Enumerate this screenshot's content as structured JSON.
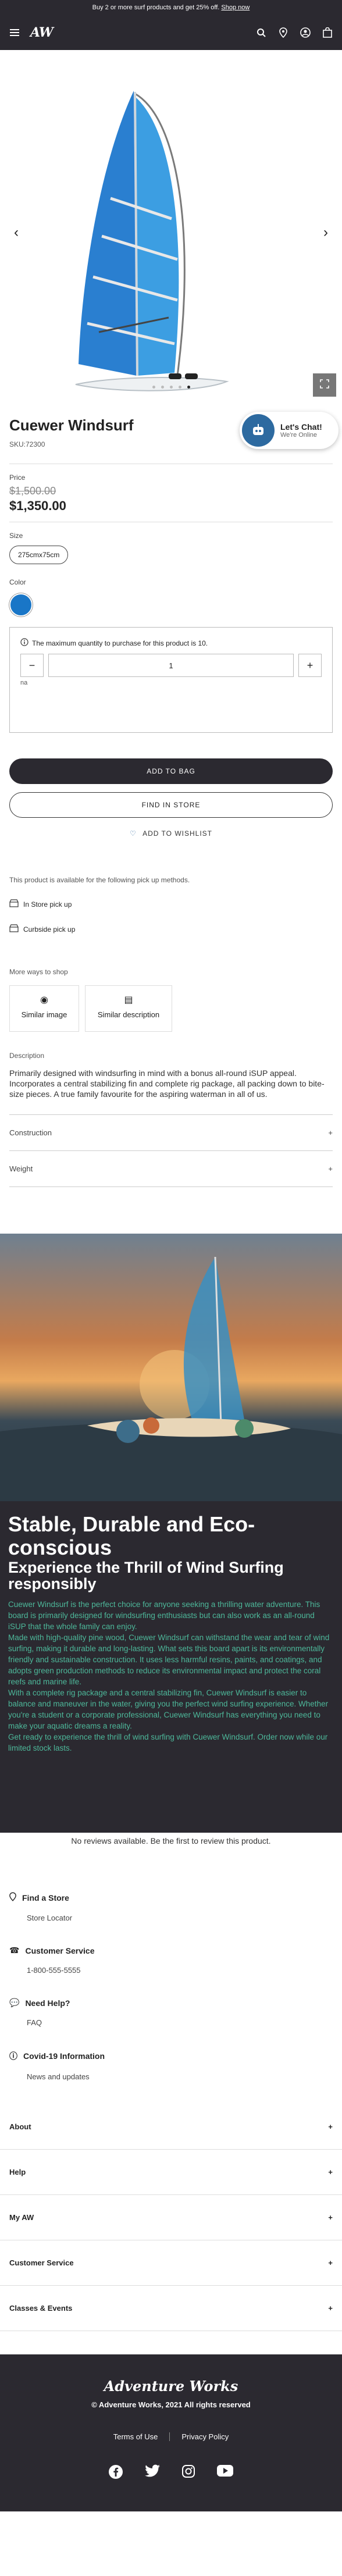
{
  "promo": {
    "text": "Buy 2 or more surf products and get 25% off.",
    "link": "Shop now"
  },
  "header": {
    "logo": "AW",
    "icons": [
      "menu-icon",
      "search-icon",
      "location-icon",
      "account-icon",
      "cart-icon"
    ]
  },
  "gallery": {
    "slide_count": 5,
    "active_index": 4
  },
  "product": {
    "title": "Cuewer Windsurf",
    "sku": "SKU:72300",
    "price_label": "Price",
    "old_price": "$1,500.00",
    "price": "$1,350.00",
    "size_label": "Size",
    "size_value": "275cmx75cm",
    "color_label": "Color",
    "color_hex": "#1976c7"
  },
  "chat": {
    "title": "Let's Chat!",
    "subtitle": "We're Online"
  },
  "quantity": {
    "message": "The maximum quantity to purchase for this product is 10.",
    "value": "1",
    "minus": "−",
    "plus": "+",
    "note": "na"
  },
  "actions": {
    "add_to_bag": "ADD TO BAG",
    "find_in_store": "FIND IN STORE",
    "wishlist": "ADD TO WISHLIST"
  },
  "pickup": {
    "intro": "This product is available for the following pick up methods.",
    "in_store": "In Store pick up",
    "curbside": "Curbside pick up"
  },
  "more_ways": {
    "title": "More ways to shop",
    "similar_image": "Similar image",
    "similar_description": "Similar description"
  },
  "description": {
    "label": "Description",
    "text": "Primarily designed with windsurfing in mind with a bonus all-round iSUP appeal. Incorporates a central stabilizing fin and complete rig package, all packing down to bite-size pieces. A true family favourite for the aspiring waterman in all of us."
  },
  "accordion": [
    "Construction",
    "Weight"
  ],
  "feature": {
    "heading": "Stable, Durable and Eco-conscious",
    "subheading": "Experience the Thrill of Wind Surfing responsibly",
    "paragraphs": [
      "Cuewer Windsurf is the perfect choice for anyone seeking a thrilling water adventure. This board is primarily designed for windsurfing enthusiasts but can also work as an all-round iSUP that the whole family can enjoy.",
      "Made with high-quality pine wood, Cuewer Windsurf can withstand the wear and tear of wind surfing, making it durable and long-lasting. What sets this board apart is its environmentally friendly and sustainable construction. It uses less harmful resins, paints, and coatings, and adopts green production methods to reduce its environmental impact and protect the coral reefs and marine life.",
      "With a complete rig package and a central stabilizing fin, Cuewer Windsurf is easier to balance and maneuver in the water, giving you the perfect wind surfing experience. Whether you're a student or a corporate professional, Cuewer Windsurf has everything you need to make your aquatic dreams a reality.",
      "Get ready to experience the thrill of wind surfing with Cuewer Windsurf. Order now while our limited stock lasts."
    ]
  },
  "reviews": {
    "text": "No reviews available. Be the first to review this product."
  },
  "info_links": [
    {
      "title": "Find a Store",
      "sub": "Store Locator",
      "icon": "location-icon"
    },
    {
      "title": "Customer Service",
      "sub": "1-800-555-5555",
      "icon": "phone-icon"
    },
    {
      "title": "Need Help?",
      "sub": "FAQ",
      "icon": "chat-icon"
    },
    {
      "title": "Covid-19 Information",
      "sub": "News and updates",
      "icon": "info-icon"
    }
  ],
  "footer_accordion": [
    "About",
    "Help",
    "My AW",
    "Customer Service",
    "Classes & Events"
  ],
  "footer": {
    "logo": "Adventure Works",
    "copyright": "© Adventure Works, 2021 All rights reserved",
    "terms": "Terms of Use",
    "privacy": "Privacy Policy",
    "social": [
      "facebook-icon",
      "twitter-icon",
      "instagram-icon",
      "youtube-icon"
    ]
  },
  "colors": {
    "dark": "#2b2930",
    "accent_green": "#4db89a",
    "swatch_blue": "#1976c7"
  }
}
